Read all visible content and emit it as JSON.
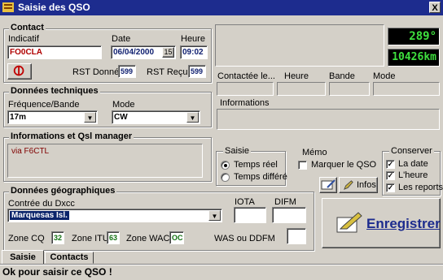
{
  "window": {
    "title": "Saisie des QSO",
    "close_glyph": "X"
  },
  "contact": {
    "title": "Contact",
    "indicatif_label": "Indicatif",
    "indicatif_value": "FO0CLA",
    "date_label": "Date",
    "date_value": "06/04/2000",
    "date_spin": "15",
    "heure_label": "Heure",
    "heure_value": "09:02",
    "rst_donne_label": "RST Donné",
    "rst_donne_value": "599",
    "rst_recu_label": "RST Reçu",
    "rst_recu_value": "599"
  },
  "techniques": {
    "title": "Données techniques",
    "freq_label": "Fréquence/Bande",
    "freq_value": "17m",
    "mode_label": "Mode",
    "mode_value": "CW"
  },
  "infos_qsl": {
    "title": "Informations et Qsl manager",
    "text": "via F6CTL"
  },
  "geo": {
    "title": "Données géographiques",
    "contree_label": "Contrée du Dxcc",
    "contree_value": "Marquesas Isl.",
    "iota_label": "IOTA",
    "difm_label": "DIFM",
    "zone_cq_label": "Zone CQ",
    "zone_cq_value": "32",
    "zone_itu_label": "Zone ITU",
    "zone_itu_value": "63",
    "zone_wac_label": "Zone WAC",
    "zone_wac_value": "OC",
    "was_label": "WAS ou DDFM"
  },
  "right": {
    "azimuth": "289°",
    "distance": "10426km",
    "col_contactee": "Contactée le...",
    "col_heure": "Heure",
    "col_bande": "Bande",
    "col_mode": "Mode",
    "informations_label": "Informations"
  },
  "saisie": {
    "title": "Saisie",
    "temps_reel": "Temps réel",
    "temps_differe": "Temps différé"
  },
  "memo": {
    "title": "Mémo",
    "marquer": "Marquer le QSO"
  },
  "conserver": {
    "title": "Conserver",
    "la_date": "La date",
    "l_heure": "L'heure",
    "les_reports": "Les reports"
  },
  "buttons": {
    "infos": "Infos",
    "enregistrer": "Enregistrer"
  },
  "tabs": [
    "Saisie",
    "Contacts"
  ],
  "status": "Ok pour saisir ce QSO !",
  "colors": {
    "titlebar": "#1d2c8e",
    "face": "#d4d0c8",
    "digital_text": "#3ee03e",
    "accent_red": "#b00000"
  }
}
